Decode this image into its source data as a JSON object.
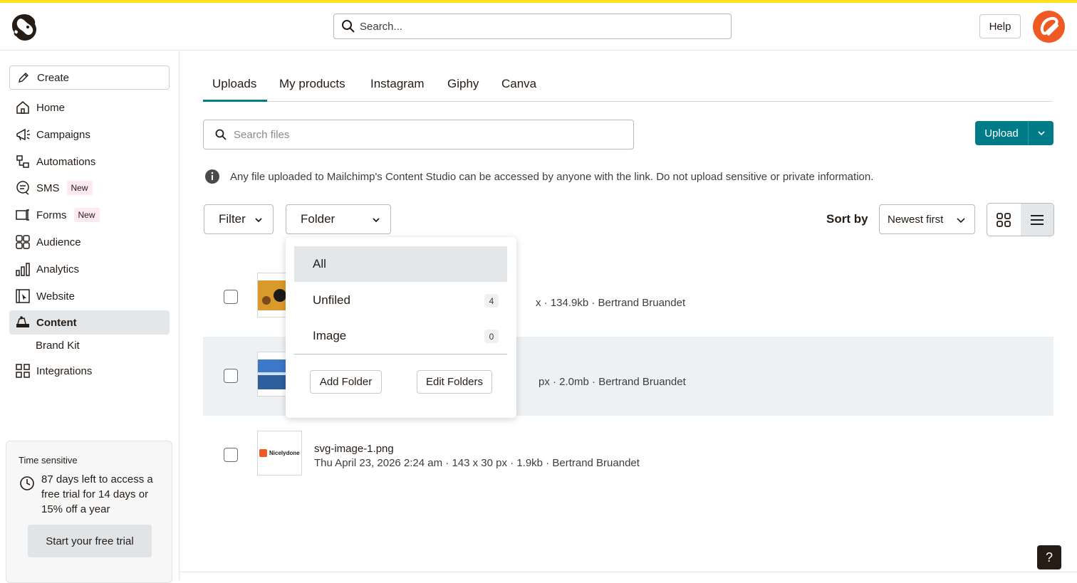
{
  "header": {
    "search_placeholder": "Search...",
    "help_label": "Help"
  },
  "sidebar": {
    "create_label": "Create",
    "items": [
      {
        "label": "Home"
      },
      {
        "label": "Campaigns"
      },
      {
        "label": "Automations"
      },
      {
        "label": "SMS",
        "badge": "New"
      },
      {
        "label": "Forms",
        "badge": "New"
      },
      {
        "label": "Audience"
      },
      {
        "label": "Analytics"
      },
      {
        "label": "Website"
      },
      {
        "label": "Content"
      },
      {
        "label": "Integrations"
      }
    ],
    "sub_item": "Brand Kit"
  },
  "trial": {
    "tag": "Time sensitive",
    "text": "87 days left to access a free trial for 14 days or 15% off a year",
    "button": "Start your free trial"
  },
  "tabs": [
    "Uploads",
    "My products",
    "Instagram",
    "Giphy",
    "Canva"
  ],
  "file_search_placeholder": "Search files",
  "upload_label": "Upload",
  "notice": "Any file uploaded to Mailchimp's Content Studio can be accessed by anyone with the link. Do not upload sensitive or private information.",
  "filter_label": "Filter",
  "folder_label": "Folder",
  "sort_label": "Sort by",
  "sort_value": "Newest first",
  "files": [
    {
      "name": "",
      "meta": "x · 134.9kb · Bertrand Bruandet"
    },
    {
      "name": "",
      "meta": "px · 2.0mb · Bertrand Bruandet"
    },
    {
      "name": "svg-image-1.png",
      "meta": "Thu April 23, 2026 2:24 am · 143 x 30 px · 1.9kb · Bertrand Bruandet"
    }
  ],
  "thumb3_text": "Nicelydone",
  "folder_menu": {
    "items": [
      {
        "label": "All",
        "count": ""
      },
      {
        "label": "Unfiled",
        "count": "4"
      },
      {
        "label": "Image",
        "count": "0"
      }
    ],
    "add_label": "Add Folder",
    "edit_label": "Edit Folders"
  },
  "help_fab": "?",
  "colors": {
    "accent": "#007c89",
    "brand_yellow": "#ffe01b",
    "avatar": "#ef5a24"
  }
}
